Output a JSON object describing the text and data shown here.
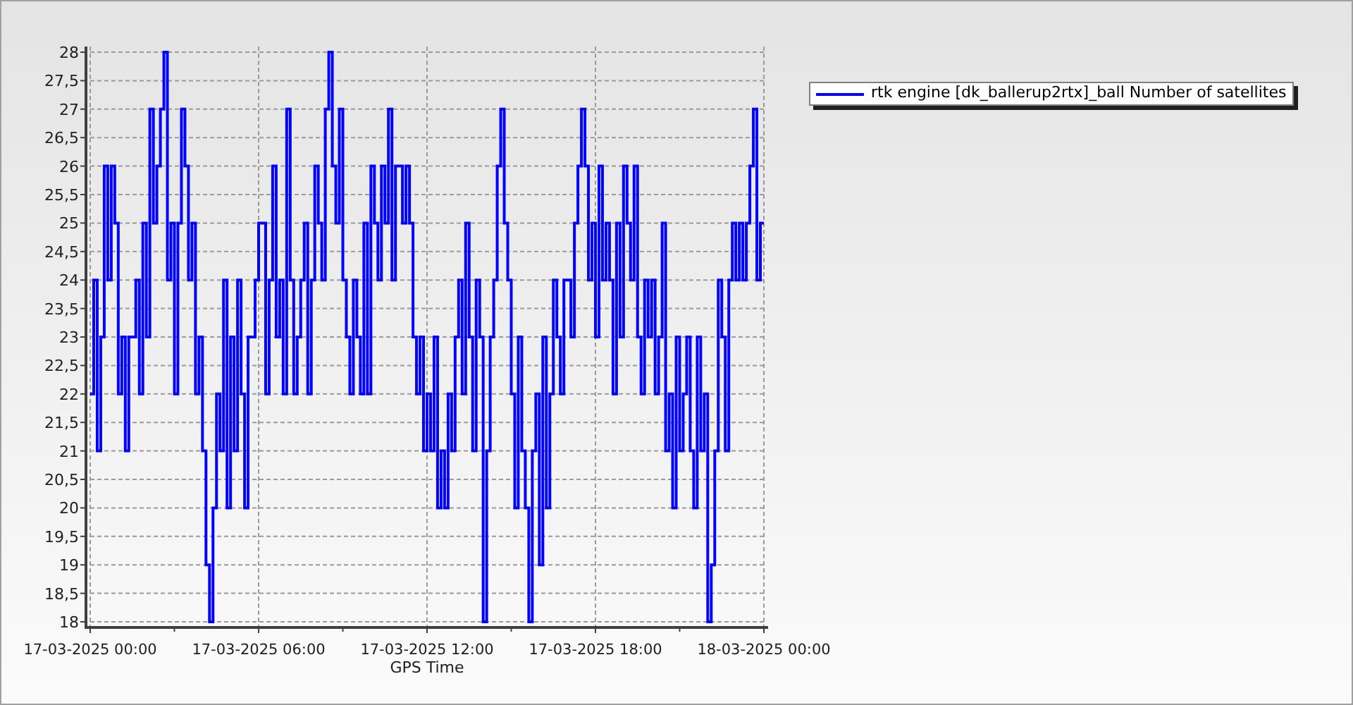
{
  "chart_data": {
    "type": "line",
    "grid": true,
    "xlabel": "GPS Time",
    "categories": [
      "17-03-2025 00:00",
      null,
      null,
      null,
      null,
      null,
      null,
      null,
      null,
      null,
      null,
      null,
      null,
      null,
      null,
      null,
      null,
      null,
      null,
      null,
      null,
      null,
      null,
      null,
      null,
      null,
      null,
      null,
      null,
      null,
      null,
      null,
      null,
      null,
      null,
      null,
      null,
      null,
      null,
      null,
      null,
      null,
      null,
      null,
      null,
      null,
      null,
      null,
      "17-03-2025 06:00",
      null,
      null,
      null,
      null,
      null,
      null,
      null,
      null,
      null,
      null,
      null,
      null,
      null,
      null,
      null,
      null,
      null,
      null,
      null,
      null,
      null,
      null,
      null,
      null,
      null,
      null,
      null,
      null,
      null,
      null,
      null,
      null,
      null,
      null,
      null,
      null,
      null,
      null,
      null,
      null,
      null,
      null,
      null,
      null,
      null,
      null,
      null,
      "17-03-2025 12:00",
      null,
      null,
      null,
      null,
      null,
      null,
      null,
      null,
      null,
      null,
      null,
      null,
      null,
      null,
      null,
      null,
      null,
      null,
      null,
      null,
      null,
      null,
      null,
      null,
      null,
      null,
      null,
      null,
      null,
      null,
      null,
      null,
      null,
      null,
      null,
      null,
      null,
      null,
      null,
      null,
      null,
      null,
      null,
      null,
      null,
      null,
      null,
      "17-03-2025 18:00",
      null,
      null,
      null,
      null,
      null,
      null,
      null,
      null,
      null,
      null,
      null,
      null,
      null,
      null,
      null,
      null,
      null,
      null,
      null,
      null,
      null,
      null,
      null,
      null,
      null,
      null,
      null,
      null,
      null,
      null,
      null,
      null,
      null,
      null,
      null,
      null,
      null,
      null,
      null,
      null,
      null,
      null,
      null,
      null,
      null,
      null,
      null,
      "18-03-2025 00:00"
    ],
    "series": [
      {
        "name": "rtk engine [dk_ballerup2rtx]_ball Number of satellites",
        "color": "#0000ff",
        "values": [
          22,
          24,
          21,
          23,
          26,
          24,
          26,
          25,
          22,
          23,
          21,
          23,
          23,
          24,
          22,
          25,
          23,
          27,
          25,
          26,
          27,
          28,
          24,
          25,
          22,
          25,
          27,
          26,
          24,
          25,
          22,
          23,
          21,
          19,
          18,
          20,
          22,
          21,
          24,
          20,
          23,
          21,
          24,
          22,
          20,
          23,
          23,
          24,
          25,
          25,
          22,
          24,
          26,
          23,
          24,
          22,
          27,
          24,
          22,
          23,
          24,
          25,
          22,
          24,
          26,
          25,
          24,
          27,
          28,
          26,
          25,
          27,
          24,
          23,
          22,
          24,
          23,
          22,
          25,
          22,
          26,
          25,
          24,
          26,
          25,
          27,
          24,
          26,
          26,
          25,
          26,
          25,
          23,
          22,
          23,
          21,
          22,
          21,
          23,
          20,
          21,
          20,
          22,
          21,
          23,
          24,
          22,
          25,
          23,
          21,
          24,
          23,
          18,
          21,
          23,
          24,
          26,
          27,
          25,
          24,
          22,
          20,
          23,
          21,
          20,
          18,
          21,
          22,
          19,
          23,
          20,
          22,
          24,
          23,
          22,
          24,
          24,
          23,
          25,
          26,
          27,
          26,
          24,
          25,
          23,
          26,
          24,
          25,
          24,
          22,
          25,
          23,
          26,
          25,
          24,
          26,
          23,
          22,
          24,
          23,
          24,
          22,
          23,
          25,
          21,
          22,
          20,
          23,
          21,
          22,
          23,
          21,
          20,
          23,
          21,
          22,
          18,
          19,
          21,
          24,
          23,
          21,
          24,
          25,
          24,
          25,
          24,
          25,
          26,
          27,
          24,
          25,
          25
        ]
      }
    ],
    "ylim": [
      18,
      28
    ],
    "yticks": [
      {
        "value": 18,
        "label": "18"
      },
      {
        "value": 18.5,
        "label": "18,5"
      },
      {
        "value": 19,
        "label": "19"
      },
      {
        "value": 19.5,
        "label": "19,5"
      },
      {
        "value": 20,
        "label": "20"
      },
      {
        "value": 20.5,
        "label": "20,5"
      },
      {
        "value": 21,
        "label": "21"
      },
      {
        "value": 21.5,
        "label": "21,5"
      },
      {
        "value": 22,
        "label": "22"
      },
      {
        "value": 22.5,
        "label": "22,5"
      },
      {
        "value": 23,
        "label": "23"
      },
      {
        "value": 23.5,
        "label": "23,5"
      },
      {
        "value": 24,
        "label": "24"
      },
      {
        "value": 24.5,
        "label": "24,5"
      },
      {
        "value": 25,
        "label": "25"
      },
      {
        "value": 25.5,
        "label": "25,5"
      },
      {
        "value": 26,
        "label": "26"
      },
      {
        "value": 26.5,
        "label": "26,5"
      },
      {
        "value": 27,
        "label": "27"
      },
      {
        "value": 27.5,
        "label": "27,5"
      },
      {
        "value": 28,
        "label": "28"
      }
    ]
  }
}
